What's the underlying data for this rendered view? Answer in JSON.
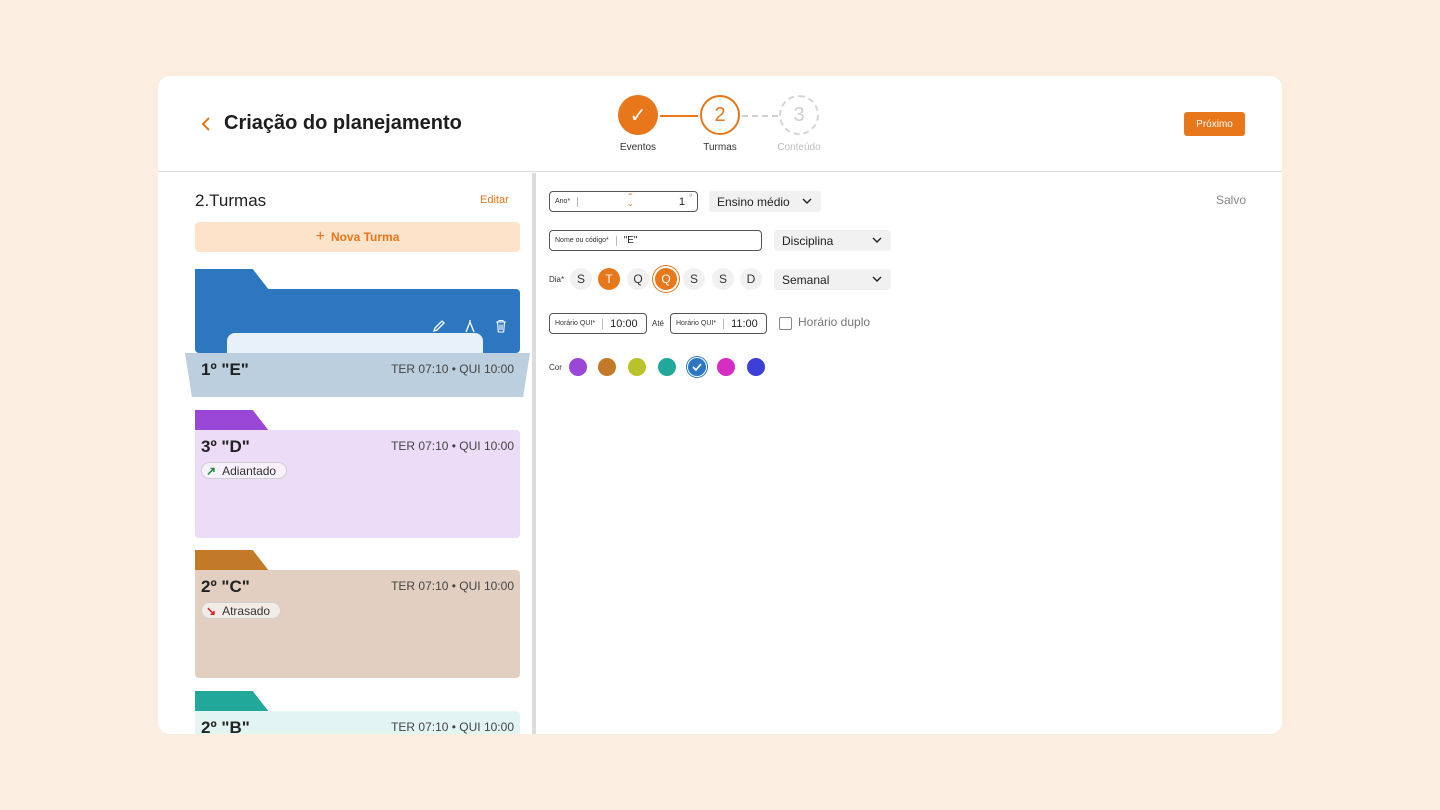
{
  "header": {
    "title": "Criação do planejamento",
    "next_label": "Próximo",
    "steps": [
      {
        "label": "Eventos",
        "mark": "✓"
      },
      {
        "label": "Turmas",
        "mark": "2"
      },
      {
        "label": "Conteúdo",
        "mark": "3"
      }
    ]
  },
  "sidebar": {
    "title": "2.Turmas",
    "edit_label": "Editar",
    "new_label": "Nova Turma",
    "classes": [
      {
        "name": "1º \"E\"",
        "schedule": "TER 07:10 • QUI 10:00",
        "color": "#2d77c0"
      },
      {
        "name": "3º \"D\"",
        "schedule": "TER 07:10 • QUI 10:00",
        "status": "Adiantado",
        "color": "#9a46d6"
      },
      {
        "name": "2º \"C\"",
        "schedule": "TER 07:10 • QUI 10:00",
        "status": "Atrasado",
        "color": "#c27a28"
      },
      {
        "name": "2º \"B\"",
        "schedule": "TER 07:10 • QUI 10:00",
        "color": "#22a89a"
      }
    ]
  },
  "form": {
    "saved_label": "Salvo",
    "year": {
      "label": "Ano*",
      "value": "1",
      "suffix": "º"
    },
    "level": "Ensino médio",
    "name_field": {
      "label": "Nome ou código*",
      "value": "\"E\""
    },
    "discipline": "Disciplina",
    "day_label": "Dia*",
    "days": [
      "S",
      "T",
      "Q",
      "Q",
      "S",
      "S",
      "D"
    ],
    "frequency": "Semanal",
    "time_start": {
      "label": "Horário QUI*",
      "value": "10:00"
    },
    "until_label": "Até",
    "time_end": {
      "label": "Horário QUI*",
      "value": "11:00"
    },
    "double_label": "Horário duplo",
    "color_label": "Cor",
    "colors": [
      "#9a46d6",
      "#c27a28",
      "#b8c22a",
      "#22a89a",
      "#2d77c0",
      "#d62ec2",
      "#3d3fd6"
    ]
  }
}
